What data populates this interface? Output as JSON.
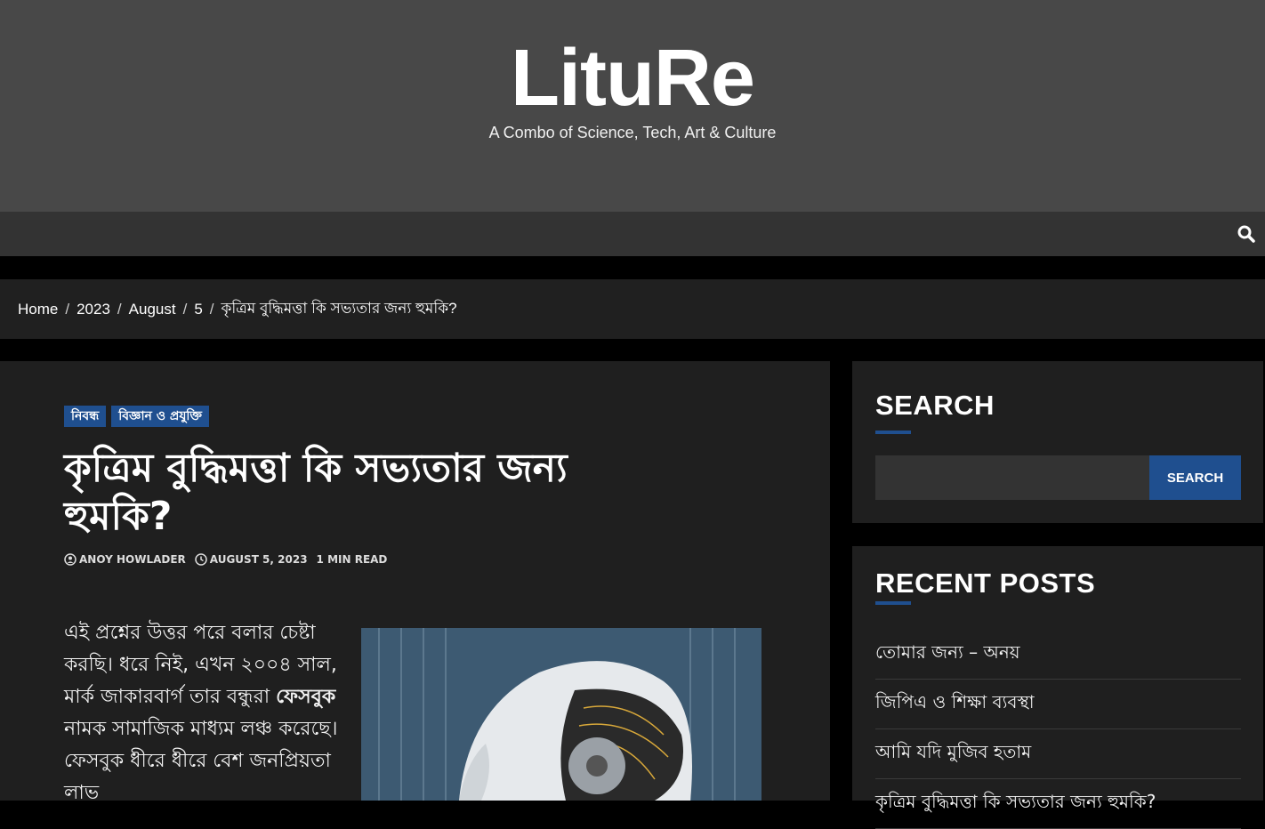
{
  "site": {
    "title": "LituRe",
    "tagline": "A Combo of Science, Tech, Art & Culture"
  },
  "nav": {
    "search_icon": "search-icon"
  },
  "breadcrumb": [
    "Home",
    "2023",
    "August",
    "5",
    "কৃত্রিম বুদ্ধিমত্তা কি সভ্যতার জন্য হুমকি?"
  ],
  "post": {
    "categories": [
      "নিবন্ধ",
      "বিজ্ঞান ও প্রযুক্তি"
    ],
    "title": "কৃত্রিম বুদ্ধিমত্তা কি সভ্যতার জন্য হুমকি?",
    "author": "ANOY HOWLADER",
    "date": "AUGUST 5, 2023",
    "read_time": "1 MIN READ",
    "body_part1": "এই প্রশ্নের উত্তর পরে বলার চেষ্টা করছি। ধরে নিই, এখন ২০০৪ সাল, মার্ক জাকারবার্গ তার বন্ধুরা ",
    "body_bold": "ফেসবুক",
    "body_part2": " নামক সামাজিক মাধ্যম লঞ্চ করেছে। ফেসবুক ধীরে ধীরে বেশ জনপ্রিয়তা লাভ"
  },
  "sidebar": {
    "search_title": "SEARCH",
    "search_placeholder": "",
    "search_button": "SEARCH",
    "recent_title": "RECENT POSTS",
    "recent_posts": [
      "তোমার জন্য – অনয়",
      "জিপিএ ও শিক্ষা ব্যবস্থা",
      "আমি যদি মুজিব হতাম",
      "কৃত্রিম বুদ্ধিমত্তা কি সভ্যতার জন্য হুমকি?"
    ]
  },
  "colors": {
    "header_bg": "#484848",
    "accent": "#1f4f8f",
    "panel_bg": "#1f1f1f"
  }
}
